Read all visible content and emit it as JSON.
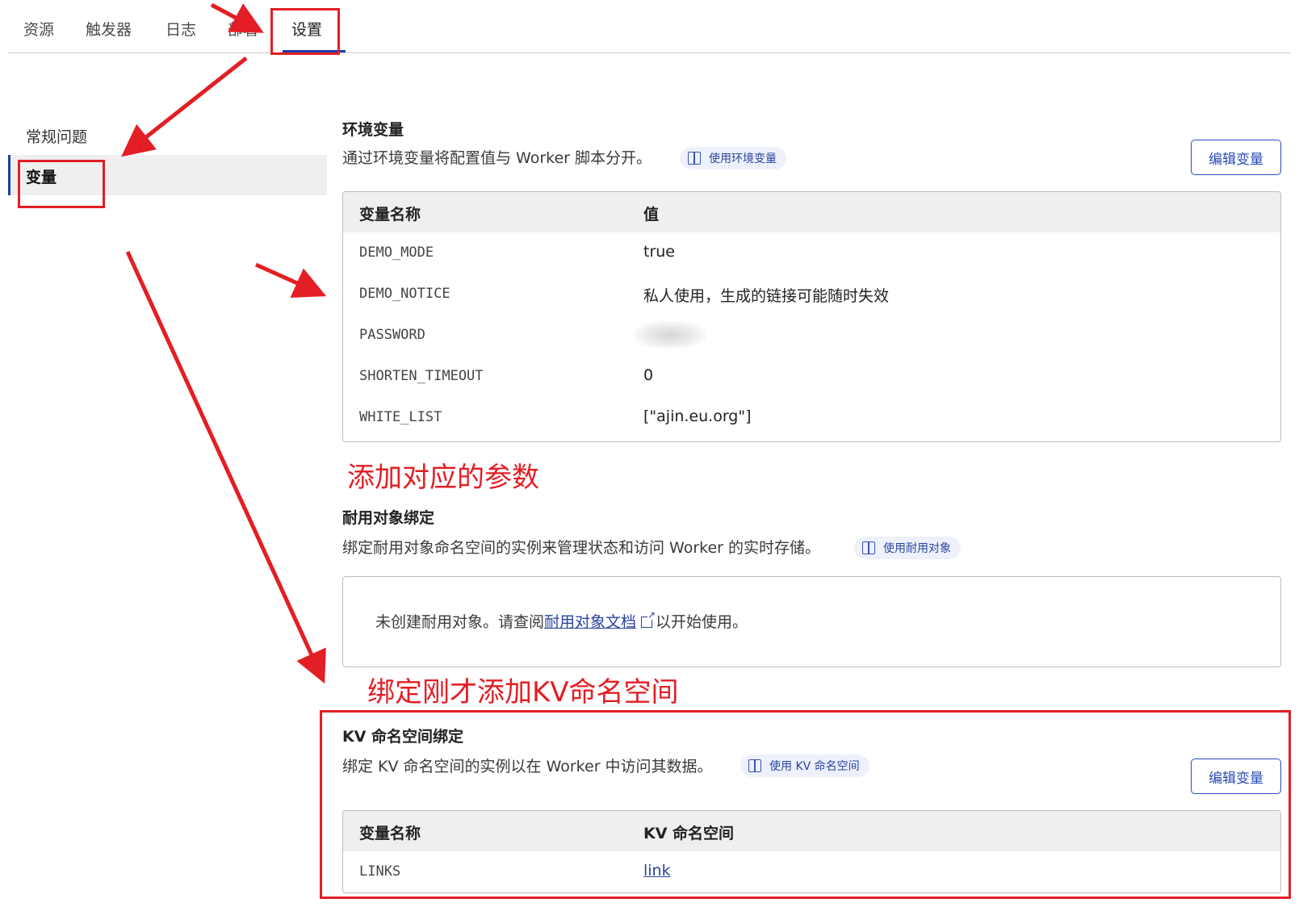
{
  "tabs": [
    {
      "label": "资源"
    },
    {
      "label": "触发器"
    },
    {
      "label": "日志"
    },
    {
      "label": "部署"
    },
    {
      "label": "设置",
      "active": true
    }
  ],
  "sidebar": {
    "items": [
      {
        "label": "常规问题"
      },
      {
        "label": "变量",
        "active": true
      }
    ]
  },
  "env_vars": {
    "title": "环境变量",
    "description": "通过环境变量将配置值与 Worker 脚本分开。",
    "doc_chip": "使用环境变量",
    "edit_button": "编辑变量",
    "columns": [
      "变量名称",
      "值"
    ],
    "rows": [
      {
        "name": "DEMO_MODE",
        "value": "true"
      },
      {
        "name": "DEMO_NOTICE",
        "value": "私人使用，生成的链接可能随时失效"
      },
      {
        "name": "PASSWORD",
        "value": ""
      },
      {
        "name": "SHORTEN_TIMEOUT",
        "value": "0"
      },
      {
        "name": "WHITE_LIST",
        "value": "[\"ajin.eu.org\"]"
      }
    ]
  },
  "durable_objects": {
    "title": "耐用对象绑定",
    "description": "绑定耐用对象命名空间的实例来管理状态和访问 Worker 的实时存储。",
    "doc_chip": "使用耐用对象",
    "empty_prefix": "未创建耐用对象。请查阅",
    "empty_link": "耐用对象文档",
    "empty_suffix": "以开始使用。"
  },
  "kv_bindings": {
    "title": "KV 命名空间绑定",
    "description": "绑定 KV 命名空间的实例以在 Worker 中访问其数据。",
    "doc_chip": "使用 KV 命名空间",
    "edit_button": "编辑变量",
    "columns": [
      "变量名称",
      "KV 命名空间"
    ],
    "rows": [
      {
        "name": "LINKS",
        "value": "link"
      }
    ]
  },
  "annotations": {
    "add_params": "添加对应的参数",
    "bind_kv": "绑定刚才添加KV命名空间",
    "color": "#e31e24"
  },
  "colors": {
    "accent": "#2b4bb5",
    "header_bg": "#efefef",
    "annotation": "#e31e24"
  }
}
